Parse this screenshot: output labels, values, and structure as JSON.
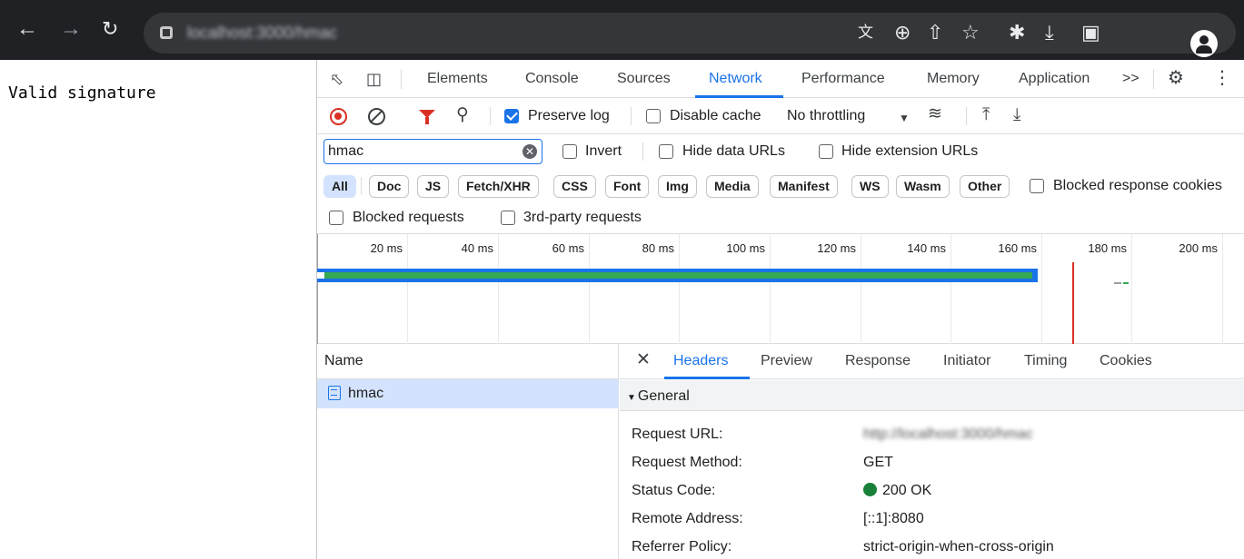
{
  "browser": {
    "url": "localhost:3000/hmac",
    "accent": "#202124",
    "toolbar_icons": [
      "translate-icon",
      "zoom-icon",
      "share-icon",
      "bookmark-star-icon",
      "extensions-icon",
      "download-icon",
      "side-panel-icon",
      "profile-icon"
    ]
  },
  "page": {
    "text": "Valid signature"
  },
  "devtools": {
    "tabs": [
      "Elements",
      "Console",
      "Sources",
      "Network",
      "Performance",
      "Memory",
      "Application"
    ],
    "active_tab": "Network",
    "more_tabs": ">>",
    "toolbar": {
      "preserve_log": "Preserve log",
      "preserve_log_checked": true,
      "disable_cache": "Disable cache",
      "disable_cache_checked": false,
      "throttling": "No throttling"
    },
    "filter": {
      "value": "hmac",
      "invert": "Invert",
      "hide_data_urls": "Hide data URLs",
      "hide_extension_urls": "Hide extension URLs"
    },
    "types": [
      "All",
      "Doc",
      "JS",
      "Fetch/XHR",
      "CSS",
      "Font",
      "Img",
      "Media",
      "Manifest",
      "WS",
      "Wasm",
      "Other"
    ],
    "active_type": "All",
    "blocked_response_cookies": "Blocked response cookies",
    "blocked_requests": "Blocked requests",
    "third_party_requests": "3rd-party requests",
    "timeline_ticks": [
      "20 ms",
      "40 ms",
      "60 ms",
      "80 ms",
      "100 ms",
      "120 ms",
      "140 ms",
      "160 ms",
      "180 ms",
      "200 ms"
    ],
    "requests_header": "Name",
    "requests": [
      {
        "name": "hmac"
      }
    ],
    "detail_tabs": [
      "Headers",
      "Preview",
      "Response",
      "Initiator",
      "Timing",
      "Cookies"
    ],
    "active_detail_tab": "Headers",
    "general_label": "General",
    "general": {
      "request_url_key": "Request URL:",
      "request_url_val": "http://localhost:3000/hmac",
      "request_method_key": "Request Method:",
      "request_method_val": "GET",
      "status_code_key": "Status Code:",
      "status_code_val": "200 OK",
      "remote_address_key": "Remote Address:",
      "remote_address_val": "[::1]:8080",
      "referrer_policy_key": "Referrer Policy:",
      "referrer_policy_val": "strict-origin-when-cross-origin"
    },
    "colors": {
      "accent": "#1a73e8",
      "record": "#d93025",
      "status_ok": "#188038",
      "waterfall_bar": "#34a853"
    }
  }
}
